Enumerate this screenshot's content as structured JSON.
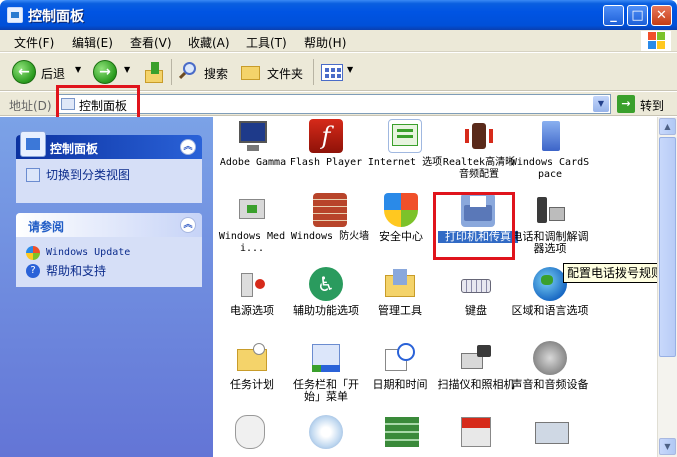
{
  "window": {
    "title": "控制面板"
  },
  "menu": [
    "文件(F)",
    "编辑(E)",
    "查看(V)",
    "收藏(A)",
    "工具(T)",
    "帮助(H)"
  ],
  "toolbar": {
    "back": "后退",
    "search": "搜索",
    "folders": "文件夹"
  },
  "address": {
    "label": "地址(D)",
    "value": "控制面板",
    "go": "转到"
  },
  "left_pane": {
    "panel1": {
      "title": "控制面板",
      "link": "切换到分类视图"
    },
    "panel2": {
      "title": "请参阅",
      "links": [
        "Windows Update",
        "帮助和支持"
      ]
    }
  },
  "items": [
    {
      "label": "Adobe Gamma",
      "icon": "monitor-icon"
    },
    {
      "label": "Flash Player",
      "icon": "flash-icon"
    },
    {
      "label": "Internet 选项",
      "icon": "internet-options-icon"
    },
    {
      "label": "Realtek高清晰音频配置",
      "icon": "speaker-icon"
    },
    {
      "label": "Windows CardSpace",
      "icon": "cardspace-icon"
    },
    {
      "label": "Windows Medi...",
      "icon": "media-icon"
    },
    {
      "label": "Windows 防火墙",
      "icon": "firewall-icon"
    },
    {
      "label": "安全中心",
      "icon": "shield-icon"
    },
    {
      "label": "打印机和传真",
      "icon": "printer-icon"
    },
    {
      "label": "电话和调制解调器选项",
      "icon": "phone-icon"
    },
    {
      "label": "电源选项",
      "icon": "power-icon"
    },
    {
      "label": "辅助功能选项",
      "icon": "accessibility-icon"
    },
    {
      "label": "管理工具",
      "icon": "admin-tools-icon"
    },
    {
      "label": "键盘",
      "icon": "keyboard-icon"
    },
    {
      "label": "区域和语言选项",
      "icon": "globe-icon"
    },
    {
      "label": "任务计划",
      "icon": "task-folder-icon"
    },
    {
      "label": "任务栏和「开始」菜单",
      "icon": "taskbar-icon"
    },
    {
      "label": "日期和时间",
      "icon": "clock-icon"
    },
    {
      "label": "扫描仪和照相机",
      "icon": "scanner-icon"
    },
    {
      "label": "声音和音频设备",
      "icon": "audio-icon"
    }
  ],
  "tooltip": "配置电话拨号规则和",
  "colors": {
    "titlebar": "#0054e3",
    "left_pane": "#7ba2e7",
    "highlight": "#e0141c",
    "selection": "#316ac5"
  }
}
